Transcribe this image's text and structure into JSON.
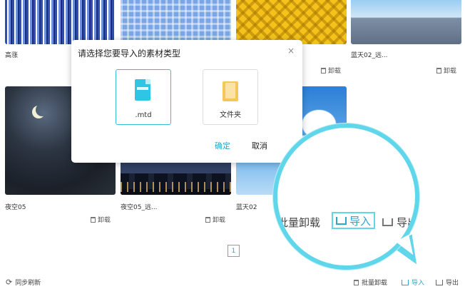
{
  "cards": [
    {
      "title": "高涨",
      "uninstall": ""
    },
    {
      "title": "",
      "uninstall": ""
    },
    {
      "title": "",
      "uninstall": "卸载"
    },
    {
      "title": "蓝天02_远...",
      "uninstall": "卸载"
    },
    {
      "title": "夜空05",
      "uninstall": "卸载"
    },
    {
      "title": "夜空05_远...",
      "uninstall": "卸载"
    },
    {
      "title": "蓝天02",
      "uninstall": ""
    }
  ],
  "dialog": {
    "title": "请选择您要导入的素材类型",
    "close": "×",
    "options": [
      {
        "label": ".mtd",
        "icon": "mtd-file-icon",
        "selected": true
      },
      {
        "label": "文件夹",
        "icon": "folder-icon",
        "selected": false
      }
    ],
    "confirm": "确定",
    "cancel": "取消"
  },
  "pagination": {
    "current": "1"
  },
  "bottom_bar": {
    "sync": "同步刷新",
    "batch_uninstall": "批量卸载",
    "import": "导入",
    "export": "导出"
  },
  "magnifier": {
    "batch_uninstall": "批量卸载",
    "import": "导入",
    "export": "导出"
  },
  "colors": {
    "accent": "#2aa7c9",
    "highlight": "#5fd6ea"
  }
}
